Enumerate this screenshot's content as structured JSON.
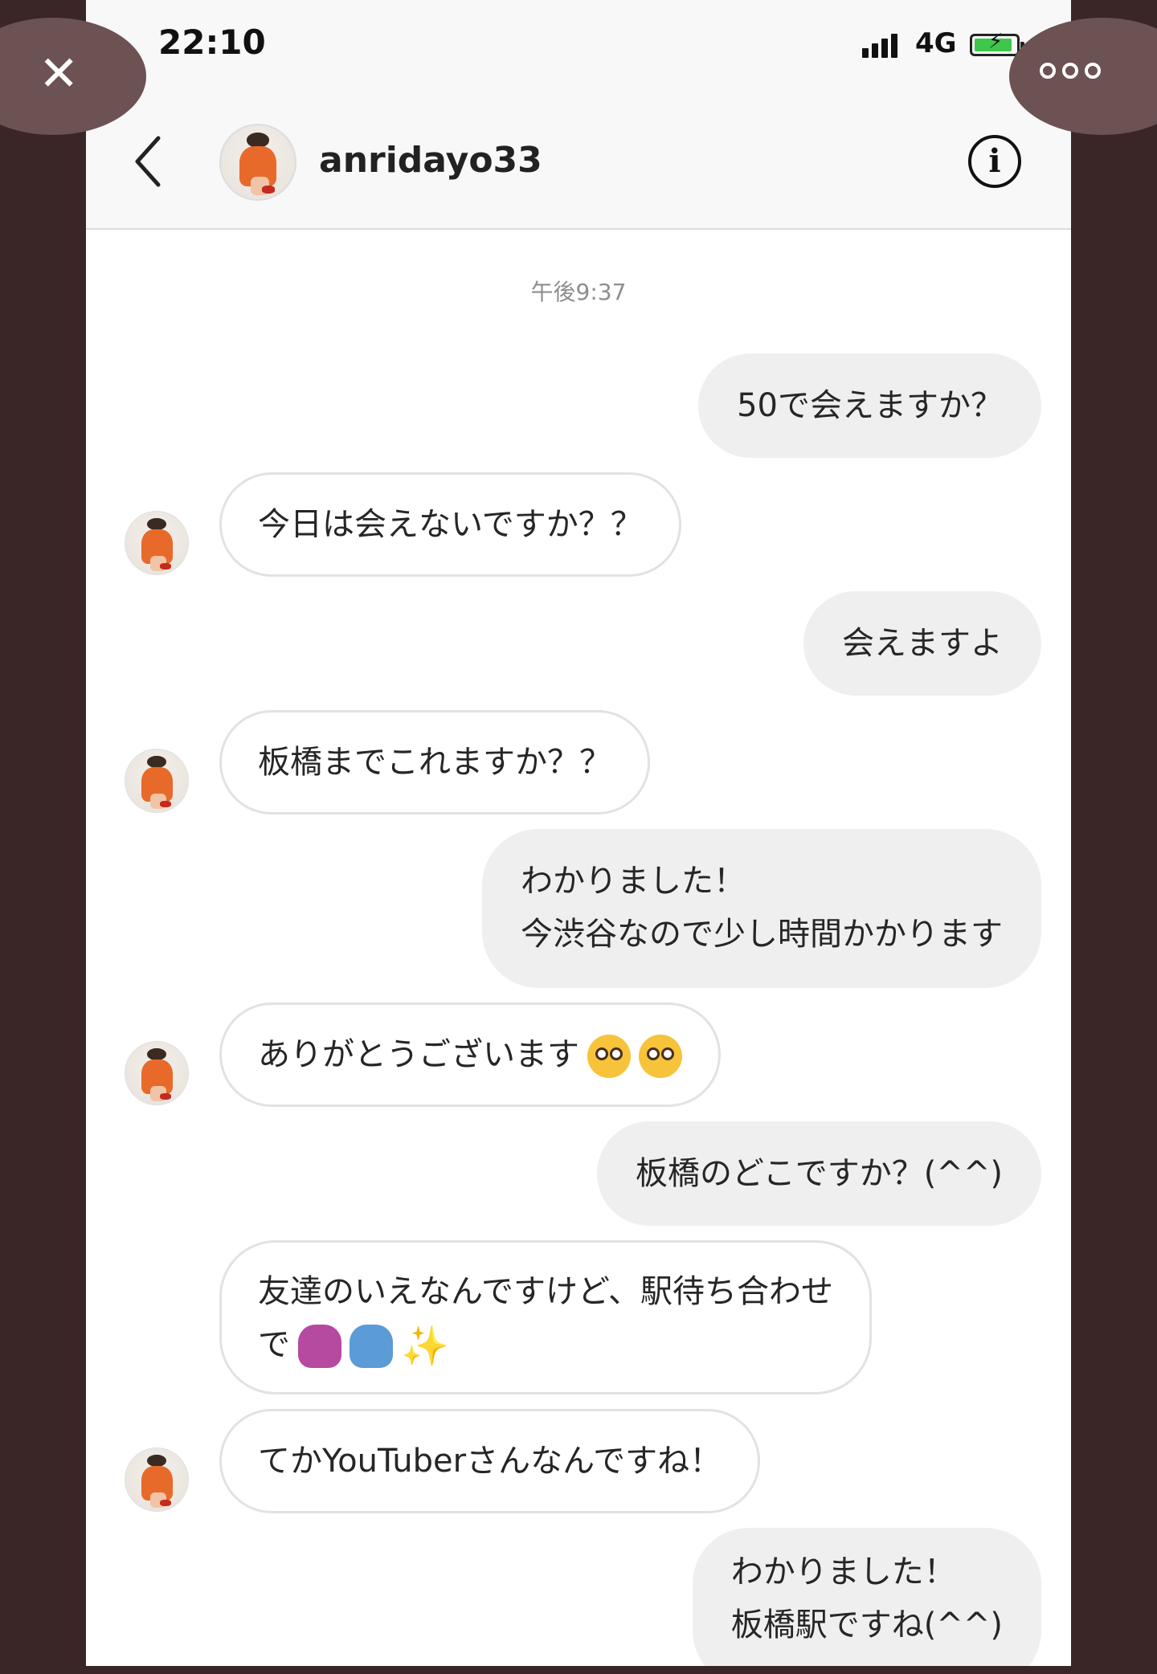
{
  "status_bar": {
    "time": "22:10",
    "network": "4G"
  },
  "header": {
    "username": "anridayo33"
  },
  "overlay": {
    "close_glyph": "✕"
  },
  "timestamp": "午後9:37",
  "messages": [
    {
      "from": "me",
      "text": "50で会えますか？"
    },
    {
      "from": "them",
      "text": "今日は会えないですか？？"
    },
    {
      "from": "me",
      "text": "会えますよ"
    },
    {
      "from": "them",
      "text": "板橋までこれますか？？"
    },
    {
      "from": "me",
      "lines": [
        "わかりました！",
        "今渋谷なので少し時間かかります"
      ]
    },
    {
      "from": "them",
      "text": "ありがとうございます",
      "emojis": [
        "pleading-face-icon",
        "pleading-face-icon"
      ]
    },
    {
      "from": "me",
      "text": "板橋のどこですか？(^^)"
    },
    {
      "from": "them",
      "lines": [
        "友達のいえなんですけど、駅待ち合わせ",
        "で"
      ],
      "emojis": [
        "person-gesturing-ok-icon",
        "person-gesturing-ok-icon",
        "sparkles-icon"
      ]
    },
    {
      "from": "them",
      "text": "てかYouTuberさんなんですね！"
    },
    {
      "from": "me",
      "lines": [
        "わかりました！",
        "板橋駅ですね(^^)"
      ]
    }
  ],
  "icons": {
    "close": "close-icon",
    "more": "more-options-icon",
    "back": "chevron-left-icon",
    "info": "info-icon"
  },
  "colors": {
    "background": "#3a2627",
    "sent_bubble": "#efefef",
    "received_border": "#e2e2e2",
    "battery": "#3ec84b"
  }
}
